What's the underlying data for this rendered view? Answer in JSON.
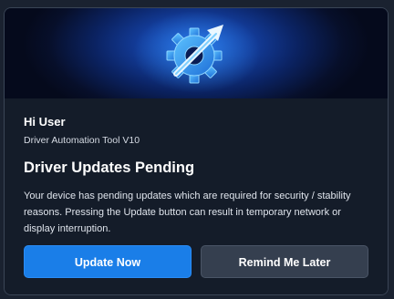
{
  "hero": {
    "icon": "gear-with-arrow-icon"
  },
  "greeting": "Hi User",
  "app_name": "Driver Automation Tool V10",
  "heading": "Driver Updates Pending",
  "message": "Your device has pending updates which are required for security / stability reasons. Pressing the Update button can result in temporary network or display interruption.",
  "buttons": {
    "primary": "Update Now",
    "secondary": "Remind Me Later"
  },
  "colors": {
    "primary_button": "#1a7ee8",
    "secondary_button": "#353f4f",
    "background": "#141c29",
    "accent": "#2f9bff"
  }
}
